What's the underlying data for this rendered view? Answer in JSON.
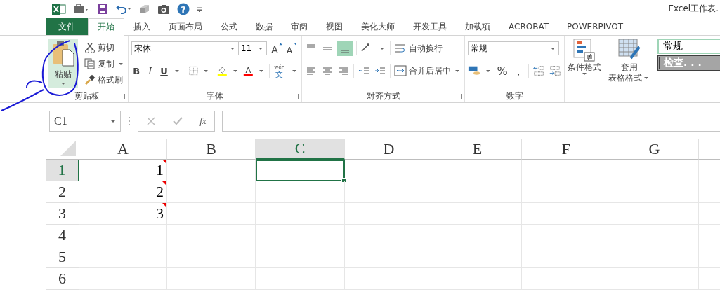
{
  "window": {
    "title": "Excel工作表."
  },
  "tabs": [
    {
      "label": "文件",
      "kind": "file",
      "selected": false
    },
    {
      "label": "开始",
      "kind": "tab",
      "selected": true
    },
    {
      "label": "插入",
      "kind": "tab",
      "selected": false
    },
    {
      "label": "页面布局",
      "kind": "tab",
      "selected": false
    },
    {
      "label": "公式",
      "kind": "tab",
      "selected": false
    },
    {
      "label": "数据",
      "kind": "tab",
      "selected": false
    },
    {
      "label": "审阅",
      "kind": "tab",
      "selected": false
    },
    {
      "label": "视图",
      "kind": "tab",
      "selected": false
    },
    {
      "label": "美化大师",
      "kind": "tab",
      "selected": false
    },
    {
      "label": "开发工具",
      "kind": "tab",
      "selected": false
    },
    {
      "label": "加载项",
      "kind": "tab",
      "selected": false
    },
    {
      "label": "ACROBAT",
      "kind": "tab",
      "selected": false
    },
    {
      "label": "POWERPIVOT",
      "kind": "tab",
      "selected": false
    }
  ],
  "clipboard": {
    "paste": "粘贴",
    "cut": "剪切",
    "copy": "复制",
    "format_painter": "格式刷",
    "label": "剪贴板"
  },
  "quick_access": {
    "help": "?"
  },
  "font": {
    "name": "宋体",
    "size": "11",
    "grow": "A",
    "shrink": "A",
    "color_glyph": "A",
    "bold": "B",
    "italic": "I",
    "underline": "U",
    "phonetic_top": "wén",
    "phonetic_bottom": "文",
    "label": "字体"
  },
  "alignment": {
    "wrap": "自动换行",
    "merge": "合并后居中",
    "label": "对齐方式"
  },
  "number": {
    "format": "常规",
    "percent": "%",
    "comma": ",",
    "label": "数字"
  },
  "styles": {
    "conditional": "条件格式",
    "table_line1": "套用",
    "table_line2": "表格格式",
    "style_normal": "常规",
    "style_check": "检查. . ."
  },
  "formula_bar": {
    "name_box": "C1",
    "fx": "fx"
  },
  "columns": [
    {
      "label": "A",
      "selected": false
    },
    {
      "label": "B",
      "selected": false
    },
    {
      "label": "C",
      "selected": true
    },
    {
      "label": "D",
      "selected": false
    },
    {
      "label": "E",
      "selected": false
    },
    {
      "label": "F",
      "selected": false
    },
    {
      "label": "G",
      "selected": false
    }
  ],
  "rows": [
    {
      "header": "1",
      "selected": true,
      "cells": [
        {
          "value": "1",
          "flag": true,
          "selected": false
        },
        {
          "selected": false
        },
        {
          "selected": true
        },
        {
          "selected": false
        },
        {
          "selected": false
        },
        {
          "selected": false
        },
        {
          "selected": false
        }
      ]
    },
    {
      "header": "2",
      "selected": false,
      "cells": [
        {
          "value": "2",
          "flag": true,
          "selected": false
        },
        {
          "selected": false
        },
        {
          "selected": false
        },
        {
          "selected": false
        },
        {
          "selected": false
        },
        {
          "selected": false
        },
        {
          "selected": false
        }
      ]
    },
    {
      "header": "3",
      "selected": false,
      "cells": [
        {
          "value": "3",
          "flag": true,
          "selected": false
        },
        {
          "selected": false
        },
        {
          "selected": false
        },
        {
          "selected": false
        },
        {
          "selected": false
        },
        {
          "selected": false
        },
        {
          "selected": false
        }
      ]
    },
    {
      "header": "4",
      "selected": false,
      "cells": [
        {
          "selected": false
        },
        {
          "selected": false
        },
        {
          "selected": false
        },
        {
          "selected": false
        },
        {
          "selected": false
        },
        {
          "selected": false
        },
        {
          "selected": false
        }
      ]
    },
    {
      "header": "5",
      "selected": false,
      "cells": [
        {
          "selected": false
        },
        {
          "selected": false
        },
        {
          "selected": false
        },
        {
          "selected": false
        },
        {
          "selected": false
        },
        {
          "selected": false
        },
        {
          "selected": false
        }
      ]
    },
    {
      "header": "6",
      "selected": false,
      "cells": [
        {
          "selected": false
        },
        {
          "selected": false
        },
        {
          "selected": false
        },
        {
          "selected": false
        },
        {
          "selected": false
        },
        {
          "selected": false
        },
        {
          "selected": false
        }
      ]
    }
  ]
}
